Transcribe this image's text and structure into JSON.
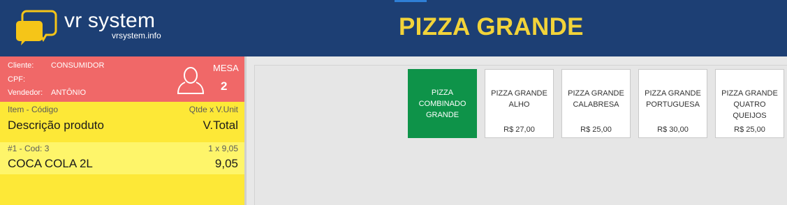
{
  "header": {
    "brand_name": "vr system",
    "brand_site": "vrsystem.info",
    "title": "PIZZA GRANDE",
    "colors": {
      "header_bg": "#1d3f74",
      "title": "#f2d33a",
      "logo": "#f5c518"
    }
  },
  "customer": {
    "cliente_label": "Cliente:",
    "cliente_value": "CONSUMIDOR",
    "cpf_label": "CPF:",
    "cpf_value": "",
    "vendedor_label": "Vendedor:",
    "vendedor_value": "ANTÔNIO",
    "mesa_label": "MESA",
    "mesa_number": "2",
    "icon": "person-icon"
  },
  "order": {
    "header": {
      "item_code": "Item - Código",
      "qty_unit": "Qtde x V.Unit",
      "description": "Descrição produto",
      "total": "V.Total"
    },
    "items": [
      {
        "index_code": "#1 - Cod: 3",
        "qty_unit": "1 x 9,05",
        "name": "COCA COLA 2L",
        "total": "9,05"
      }
    ]
  },
  "products": [
    {
      "name": "PIZZA COMBINADO GRANDE",
      "price": "",
      "selected": true
    },
    {
      "name": "PIZZA GRANDE ALHO",
      "price": "R$ 27,00",
      "selected": false
    },
    {
      "name": "PIZZA GRANDE CALABRESA",
      "price": "R$ 25,00",
      "selected": false
    },
    {
      "name": "PIZZA GRANDE PORTUGUESA",
      "price": "R$ 30,00",
      "selected": false
    },
    {
      "name": "PIZZA GRANDE QUATRO QUEIJOS",
      "price": "R$ 25,00",
      "selected": false
    }
  ]
}
